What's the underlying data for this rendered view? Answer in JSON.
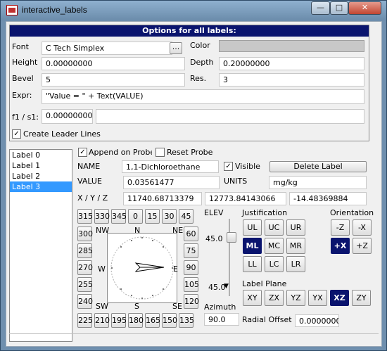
{
  "window": {
    "title": "interactive_labels",
    "min_glyph": "—",
    "max_glyph": "□",
    "close_glyph": "✕"
  },
  "options": {
    "banner": "Options for all labels:",
    "font_label": "Font",
    "font_value": "C Tech Simplex",
    "font_browse": "...",
    "color_label": "Color",
    "color_value": "#c8c8c8",
    "height_label": "Height",
    "height_value": "0.00000000",
    "depth_label": "Depth",
    "depth_value": "0.20000000",
    "bevel_label": "Bevel",
    "bevel_value": "5",
    "res_label": "Res.",
    "res_value": "3",
    "expr_label": "Expr:",
    "expr_value": "\"Value = \" + Text(VALUE)",
    "f1_label": "f1 / s1:",
    "f1_value": "0.00000000",
    "s1_value": "",
    "leader_label": "Create Leader Lines",
    "leader_checked": true
  },
  "labels_list": [
    "Label 0",
    "Label 1",
    "Label 2",
    "Label 3"
  ],
  "selected_label_index": 3,
  "probe": {
    "append_label": "Append on Probe",
    "append_checked": true,
    "reset_label": "Reset Probe",
    "reset_checked": false
  },
  "details": {
    "name_label": "NAME",
    "name_value": "1,1-Dichloroethane",
    "visible_label": "Visible",
    "visible_checked": true,
    "delete_label": "Delete Label",
    "value_label": "VALUE",
    "value_value": "0.03561477",
    "units_label": "UNITS",
    "units_value": "mg/kg",
    "xyz_label": "X / Y / Z",
    "x_value": "11740.68713379",
    "y_value": "12773.84143066",
    "z_value": "-14.48369884"
  },
  "azimuth_buttons_top": [
    "315",
    "330",
    "345",
    "0",
    "15",
    "30",
    "45"
  ],
  "azimuth_buttons_left": [
    "300",
    "285",
    "270",
    "255",
    "240"
  ],
  "azimuth_buttons_right": [
    "60",
    "75",
    "90",
    "105",
    "120"
  ],
  "azimuth_buttons_bottom": [
    "225",
    "210",
    "195",
    "180",
    "165",
    "150",
    "135"
  ],
  "compass": {
    "nw": "NW",
    "n": "N",
    "ne": "NE",
    "w": "W",
    "e": "E",
    "sw": "SW",
    "s": "S",
    "se": "SE"
  },
  "elev": {
    "label": "ELEV",
    "top_value": "45.0",
    "bottom_value": "45.0",
    "down_glyph": "▼"
  },
  "azimuth": {
    "label": "Azimuth",
    "value": "90.0"
  },
  "justification": {
    "label": "Justification",
    "buttons": [
      "UL",
      "UC",
      "UR",
      "ML",
      "MC",
      "MR",
      "LL",
      "LC",
      "LR"
    ],
    "selected": "ML"
  },
  "orientation": {
    "label": "Orientation",
    "buttons": [
      "-Z",
      "-X",
      "+X",
      "+Z"
    ],
    "selected": "+X"
  },
  "label_plane": {
    "label": "Label Plane",
    "buttons": [
      "XY",
      "ZX",
      "YZ",
      "YX",
      "XZ",
      "ZY"
    ],
    "selected": "XZ"
  },
  "radial_offset": {
    "label": "Radial Offset",
    "value": "0.0000000"
  }
}
